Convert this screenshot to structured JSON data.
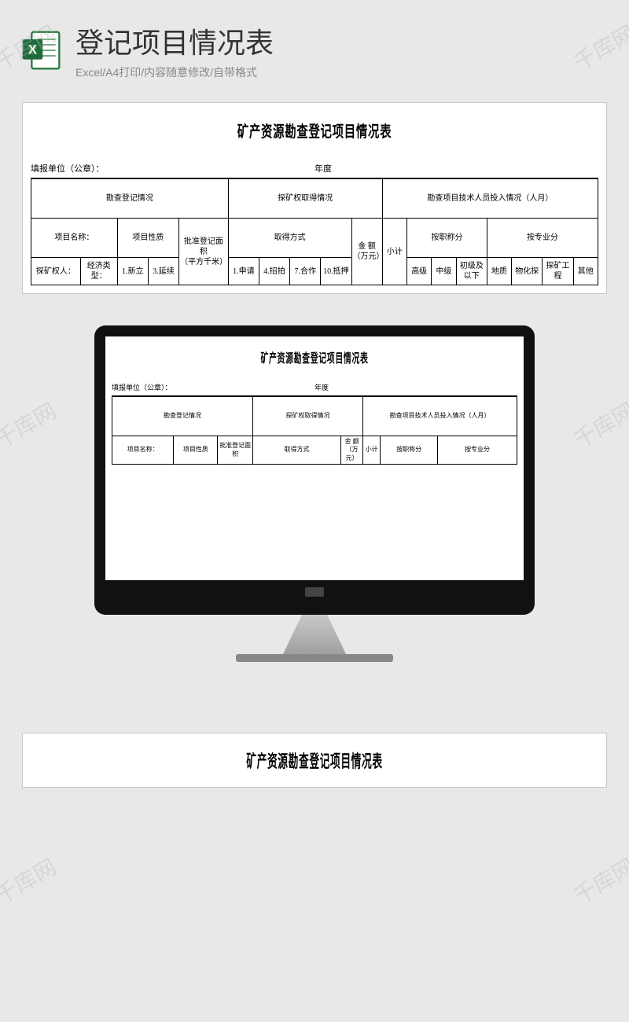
{
  "watermark": "千库网",
  "header": {
    "title": "登记项目情况表",
    "subtitle": "Excel/A4打印/内容随意修改/自带格式"
  },
  "doc": {
    "title": "矿产资源勘查登记项目情况表",
    "meta_left": "填报单位（公章）：",
    "meta_right": "年度",
    "section1": "勘查登记情况",
    "section2": "探矿权取得情况",
    "section3": "勘查项目技术人员投入情况（人月）",
    "row2": {
      "c1": "项目名称：",
      "c2": "项目性质",
      "c3": "批准登记面积",
      "c4": "取得方式",
      "c5": "金 额（万元）",
      "c6": "按职称分",
      "c7": "按专业分"
    },
    "row3": {
      "c1": "探矿权人：",
      "c2": "经济类型：",
      "c3a": "1.新立",
      "c3b": "3.延续",
      "c4": "（平方千米）",
      "c5a": "1.申请",
      "c5b": "4.招拍",
      "c5c": "7.合作",
      "c5d": "10.抵押",
      "c6": "小计",
      "c7a": "高级",
      "c7b": "中级",
      "c7c": "初级及以下",
      "c8a": "地质",
      "c8b": "物化探",
      "c8c": "探矿工程",
      "c8d": "其他"
    }
  }
}
